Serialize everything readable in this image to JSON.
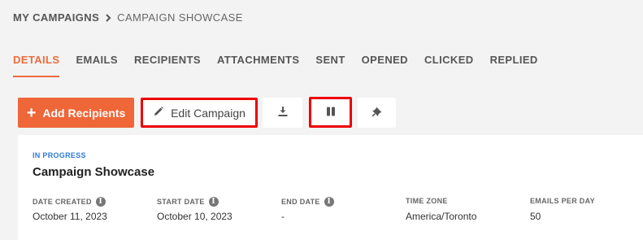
{
  "breadcrumb": {
    "root": "MY CAMPAIGNS",
    "current": "CAMPAIGN SHOWCASE"
  },
  "tabs": [
    {
      "label": "DETAILS",
      "active": true
    },
    {
      "label": "EMAILS",
      "active": false
    },
    {
      "label": "RECIPIENTS",
      "active": false
    },
    {
      "label": "ATTACHMENTS",
      "active": false
    },
    {
      "label": "SENT",
      "active": false
    },
    {
      "label": "OPENED",
      "active": false
    },
    {
      "label": "CLICKED",
      "active": false
    },
    {
      "label": "REPLIED",
      "active": false
    }
  ],
  "toolbar": {
    "add_label": "Add Recipients",
    "edit_label": "Edit Campaign",
    "icons": [
      "plus-icon",
      "pencil-icon",
      "download-icon",
      "pause-icon",
      "pin-icon"
    ]
  },
  "campaign": {
    "status": "IN PROGRESS",
    "title": "Campaign Showcase",
    "fields": [
      {
        "label": "DATE CREATED",
        "value": "October 11, 2023",
        "info": true
      },
      {
        "label": "START DATE",
        "value": "October 10, 2023",
        "info": true
      },
      {
        "label": "END DATE",
        "value": "-",
        "info": true
      },
      {
        "label": "TIME ZONE",
        "value": "America/Toronto",
        "info": false
      },
      {
        "label": "EMAILS PER DAY",
        "value": "50",
        "info": false
      }
    ]
  },
  "colors": {
    "accent": "#ef6638",
    "status": "#2f7bd6",
    "highlight": "#ee0000",
    "background": "#f3f3f3"
  }
}
